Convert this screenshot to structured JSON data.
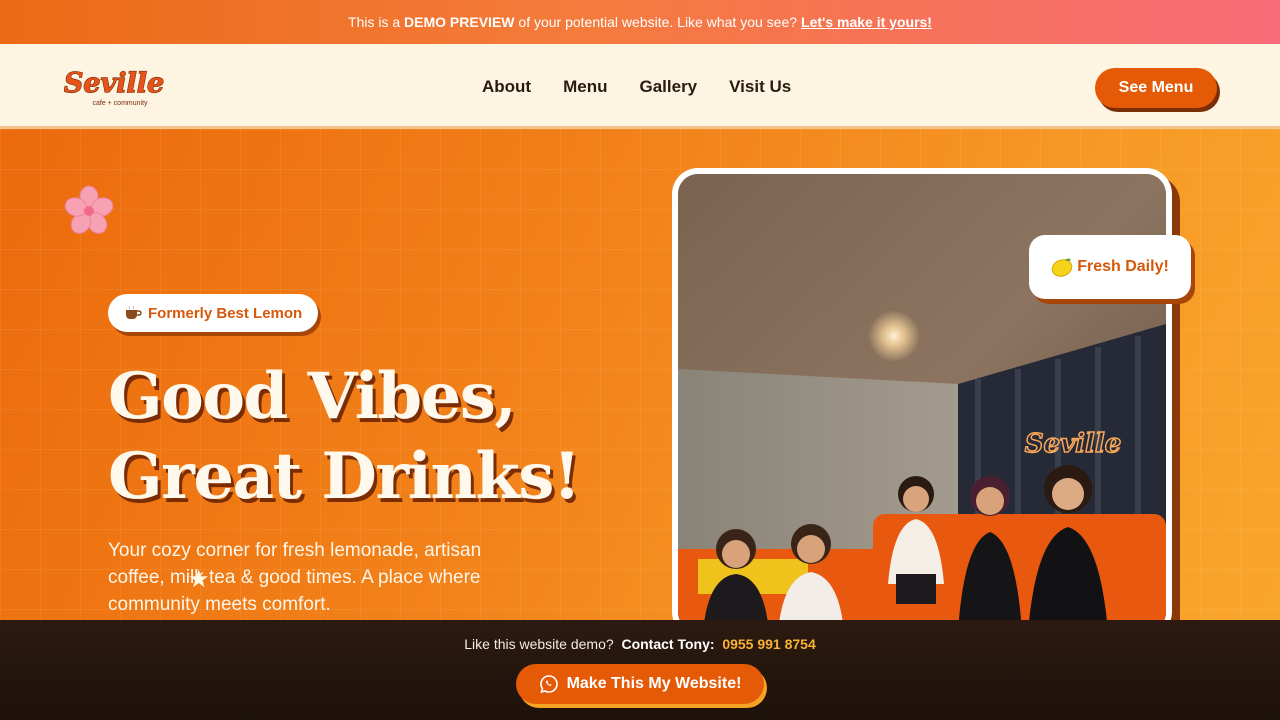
{
  "demo_banner": {
    "prefix": "This is a",
    "highlight": "DEMO PREVIEW",
    "middle": "of your potential website. Like what you see?",
    "link": "Let's make it yours!"
  },
  "nav": {
    "logo_text": "Seville",
    "logo_tagline": "cafe + community",
    "links": [
      "About",
      "Menu",
      "Gallery",
      "Visit Us"
    ],
    "cta": "See Menu"
  },
  "hero": {
    "badge_icon": "coffee-cup-icon",
    "badge": "Formerly Best Lemon",
    "headline_line1": "Good Vibes,",
    "headline_line2": "Great Drinks!",
    "subtext": "Your cozy corner for fresh lemonade, artisan coffee, milk tea & good times. A place where community meets comfort.",
    "fresh_icon": "lemon-icon",
    "fresh_badge": "Fresh Daily!",
    "photo_sign": "Seville"
  },
  "contact": {
    "prefix": "Like this website demo?",
    "label": "Contact Tony:",
    "phone": "0955 991 8754",
    "button": "Make This My Website!",
    "button_icon": "whatsapp-icon"
  },
  "colors": {
    "accent": "#e55a07",
    "cream": "#fdf5e2",
    "dark": "#1d120b",
    "phone_highlight": "#f9b233"
  }
}
